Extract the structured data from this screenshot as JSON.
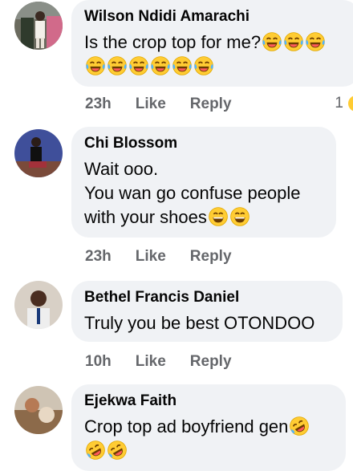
{
  "comments": [
    {
      "author": "Wilson Ndidi Amarachi",
      "text": "Is the crop top for me?",
      "emoji_line1": 3,
      "emoji_line2": 6,
      "emoji_type": "tears-of-joy",
      "time": "23h",
      "like": "Like",
      "reply": "Reply",
      "reaction_count": "1"
    },
    {
      "author": "Chi Blossom",
      "line1": "Wait ooo.",
      "line2": "You wan go confuse people",
      "line3": "with your shoes",
      "emoji_type": "grinning",
      "time": "23h",
      "like": "Like",
      "reply": "Reply"
    },
    {
      "author": "Bethel Francis Daniel",
      "text": "Truly you be best OTONDOO",
      "time": "10h",
      "like": "Like",
      "reply": "Reply"
    },
    {
      "author": "Ejekwa Faith",
      "text": "Crop top ad boyfriend gen",
      "emoji_type": "rolling-on-floor-laughing"
    }
  ],
  "colors": {
    "bubble": "#f0f2f5",
    "meta": "#65676b",
    "emoji_yellow": "#ffcc33"
  }
}
